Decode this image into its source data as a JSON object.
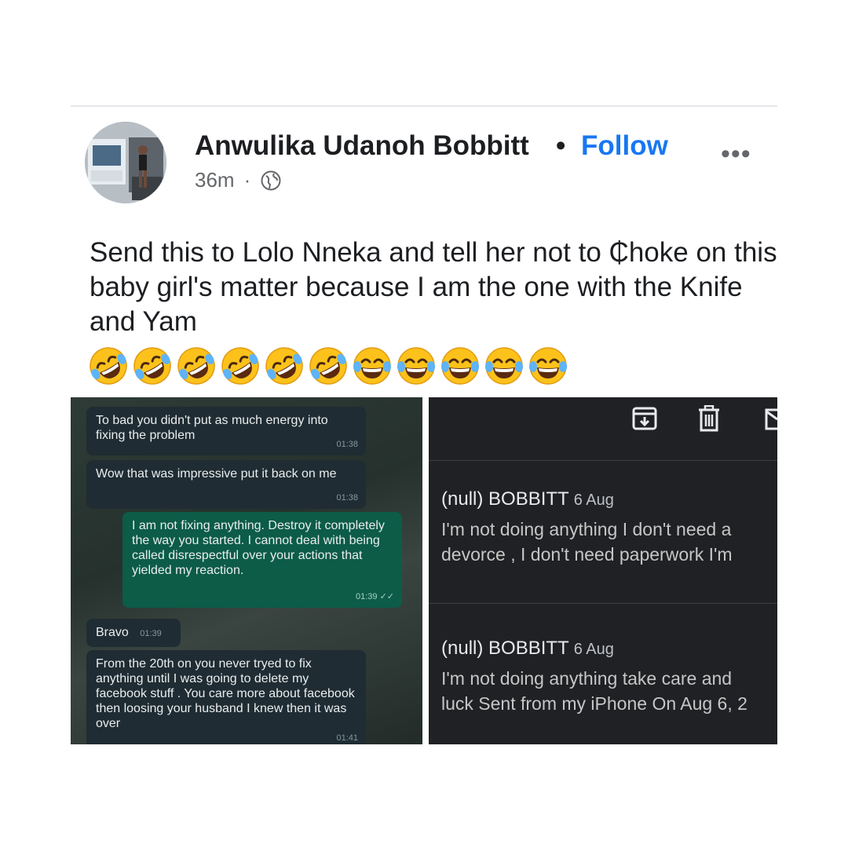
{
  "post": {
    "author": "Anwulika Udanoh Bobbitt",
    "separator_dot": "•",
    "follow_label": "Follow",
    "more_label": "•••",
    "time": "36m",
    "meta_separator": "·",
    "privacy_icon": "globe-icon",
    "text": "Send this to Lolo Nneka and tell her not to ₵hoke on this baby girl's matter because I am the one with the Knife and Yam",
    "emojis": [
      "rolling-on-floor-laughing",
      "rolling-on-floor-laughing",
      "rolling-on-floor-laughing",
      "rolling-on-floor-laughing",
      "rolling-on-floor-laughing",
      "rolling-on-floor-laughing",
      "face-with-tears-of-joy",
      "face-with-tears-of-joy",
      "face-with-tears-of-joy",
      "face-with-tears-of-joy",
      "face-with-tears-of-joy"
    ],
    "link_color": "#1877f2"
  },
  "chat": {
    "messages": [
      {
        "text": "To bad you didn't put as much energy into fixing the problem",
        "time": "01:38",
        "direction": "incoming"
      },
      {
        "text": "Wow that was impressive put it back on me",
        "time": "01:38",
        "direction": "incoming"
      },
      {
        "text": "I am not fixing anything. Destroy it completely the way you started. I cannot deal with being called disrespectful over your actions that yielded my reaction.",
        "time": "01:39",
        "direction": "outgoing",
        "status": "✓✓"
      },
      {
        "text": "Bravo",
        "time": "01:39",
        "direction": "incoming"
      },
      {
        "text": "From the 20th on you never tryed to fix anything until I was going to delete my facebook stuff . You care more about facebook then loosing your husband I knew then it was over",
        "time": "01:41",
        "direction": "incoming"
      }
    ],
    "incoming_color": "#1f2c33",
    "outgoing_color": "#0c5c48"
  },
  "email": {
    "toolbar_icons": [
      "archive-icon",
      "delete-icon",
      "mail-icon"
    ],
    "items": [
      {
        "sender": "(null) BOBBITT",
        "date": "6 Aug",
        "snippet_line1": "I'm not doing anything I don't need a",
        "snippet_line2": "devorce , I don't need paperwork I'm"
      },
      {
        "sender": "(null) BOBBITT",
        "date": "6 Aug",
        "snippet_line1": "I'm not doing anything take care and",
        "snippet_line2": "luck Sent from my iPhone On Aug 6, 2"
      }
    ],
    "background_color": "#202124"
  }
}
